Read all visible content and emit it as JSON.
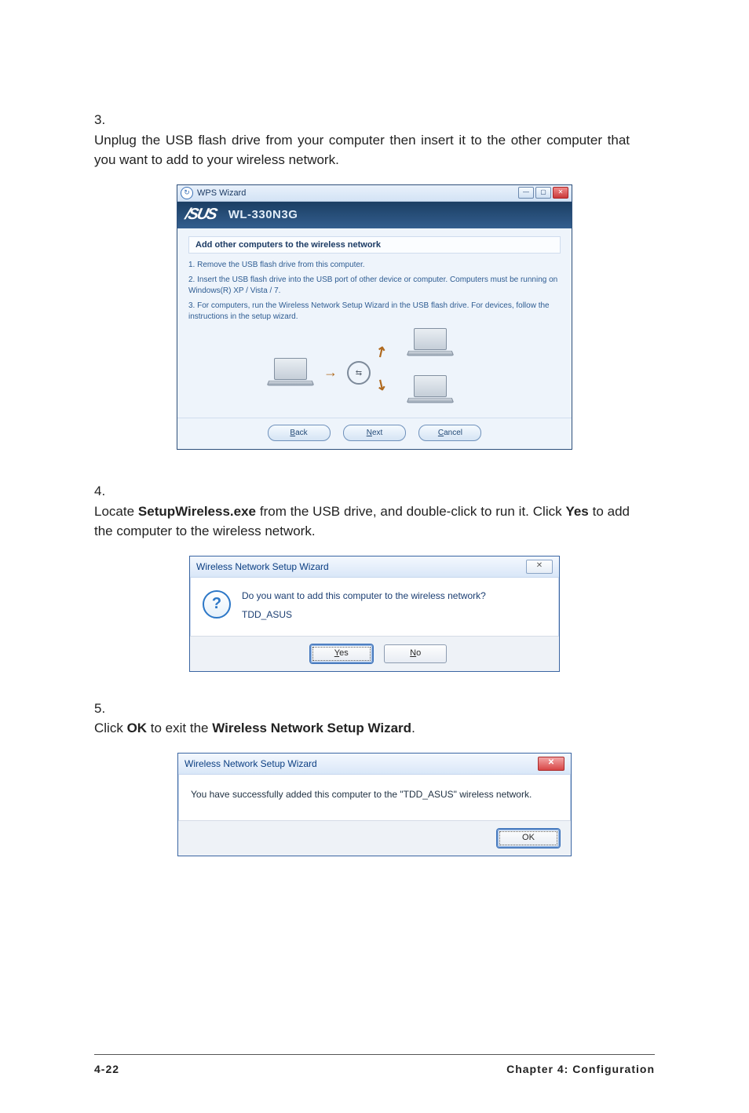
{
  "steps": {
    "s3": {
      "num": "3.",
      "text": "Unplug the USB flash drive from your computer then insert it to the other computer that you want to add to your wireless network."
    },
    "s4": {
      "num": "4.",
      "pre": "Locate ",
      "b1": "SetupWireless.exe",
      "mid": " from the USB drive, and double-click to run it. Click ",
      "b2": "Yes",
      "post": " to add the computer to the wireless network."
    },
    "s5": {
      "num": "5.",
      "pre": "Click ",
      "b1": "OK",
      "mid": " to exit the ",
      "b2": "Wireless Network Setup Wizard",
      "post": "."
    }
  },
  "wps": {
    "title": "WPS Wizard",
    "model": "WL-330N3G",
    "heading": "Add other computers to the wireless network",
    "p1": "1. Remove the USB flash drive from this computer.",
    "p2": "2. Insert the USB flash drive into the USB port of other device or computer. Computers must be running on Windows(R) XP / Vista / 7.",
    "p3": "3. For computers, run the Wireless Network Setup Wizard in the USB flash drive. For devices, follow the instructions in the setup wizard.",
    "back_u": "B",
    "back_rest": "ack",
    "next_u": "N",
    "next_rest": "ext",
    "cancel_u": "C",
    "cancel_rest": "ancel"
  },
  "dlg1": {
    "title": "Wireless Network Setup Wizard",
    "close": "✕",
    "line1": "Do you want to add this computer to the wireless network?",
    "line2": "TDD_ASUS",
    "yes_u": "Y",
    "yes_rest": "es",
    "no_u": "N",
    "no_rest": "o",
    "qmark": "?"
  },
  "dlg2": {
    "title": "Wireless Network Setup Wizard",
    "close": "✕",
    "body": "You have successfully added this computer to the \"TDD_ASUS\" wireless network.",
    "ok": "OK"
  },
  "footer": {
    "page": "4-22",
    "chapter": "Chapter 4: Configuration"
  }
}
